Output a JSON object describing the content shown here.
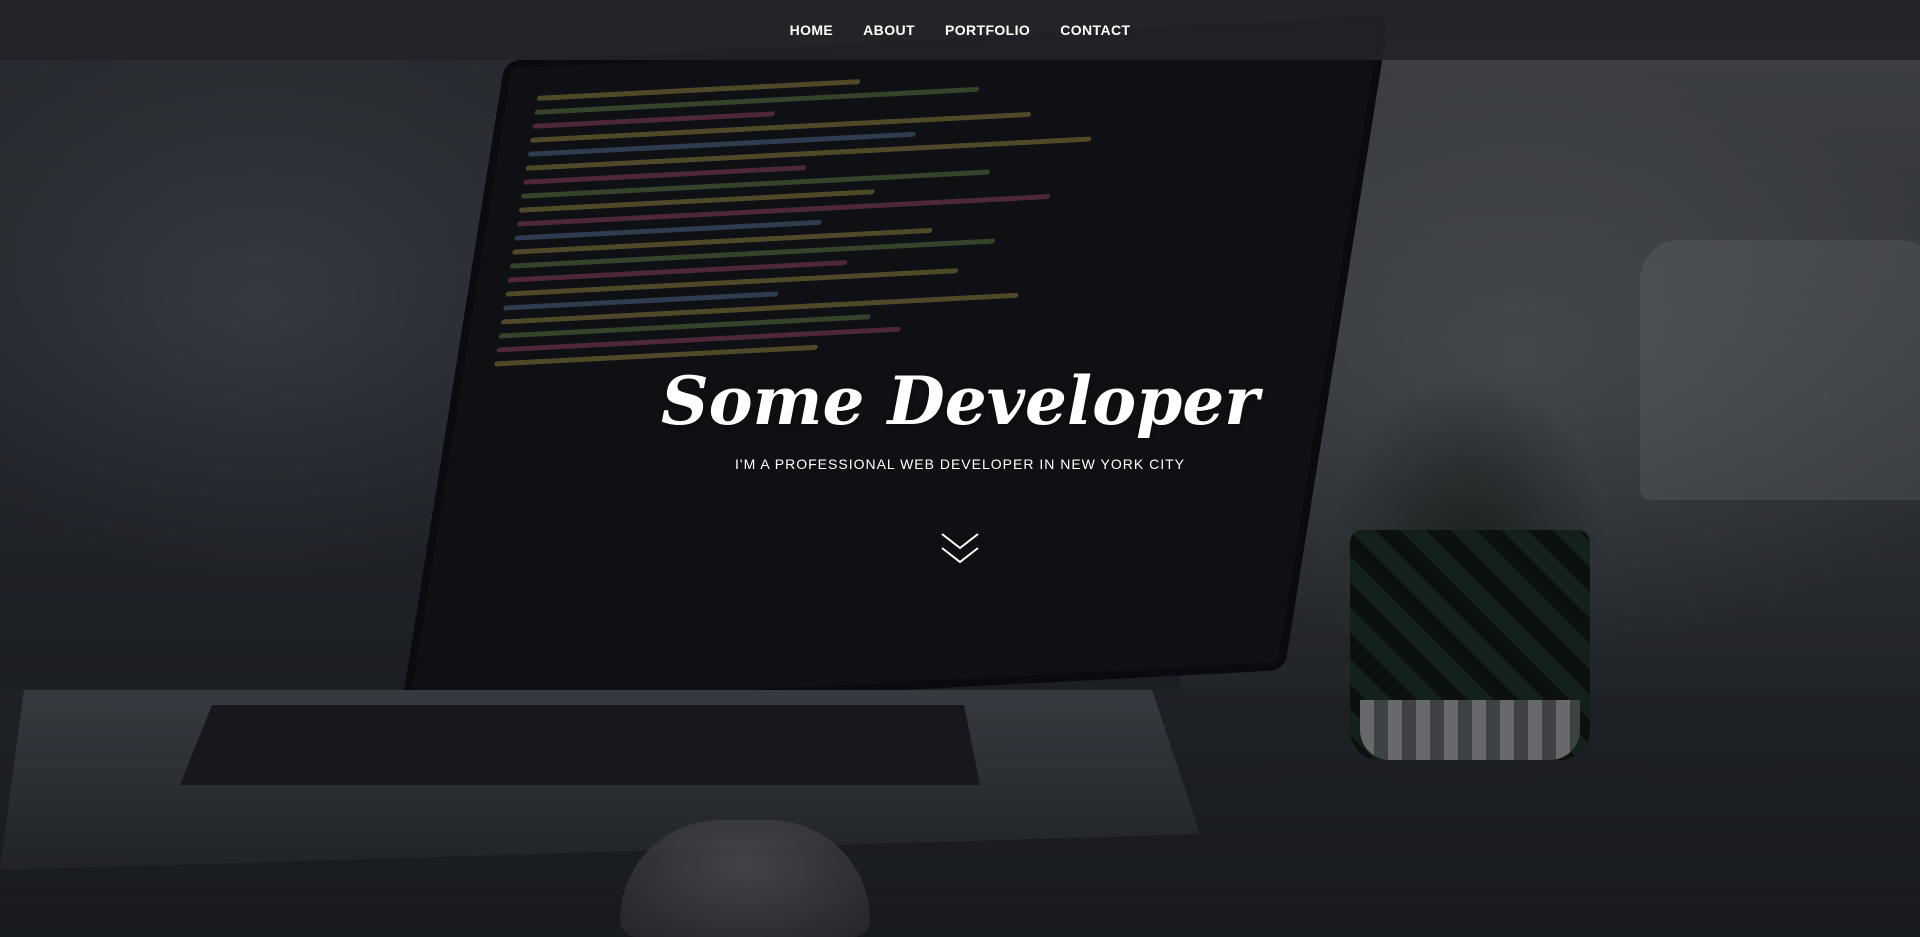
{
  "nav": {
    "items": [
      {
        "label": "HOME"
      },
      {
        "label": "ABOUT"
      },
      {
        "label": "PORTFOLIO"
      },
      {
        "label": "CONTACT"
      }
    ]
  },
  "hero": {
    "title": "Some Developer",
    "subtitle": "I'M A PROFESSIONAL WEB DEVELOPER IN NEW YORK CITY",
    "scroll_icon": "double-chevron-down-icon"
  },
  "colors": {
    "nav_bg": "#222428",
    "text": "#ffffff",
    "overlay": "#0a0b0f"
  }
}
